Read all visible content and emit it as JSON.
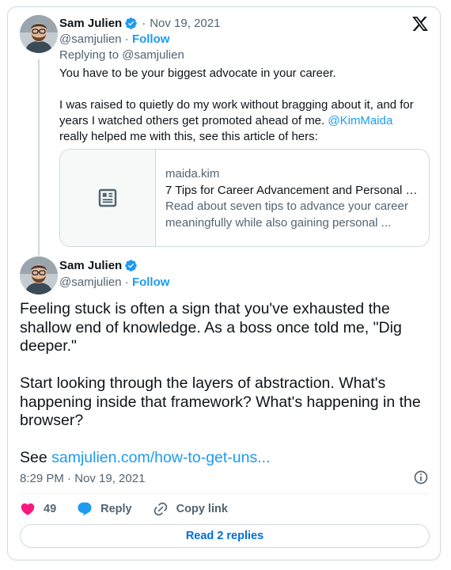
{
  "brand": {
    "logo_icon": "x-logo-icon",
    "verified_color": "#1d9bf0",
    "like_color": "#f91880"
  },
  "parent_tweet": {
    "author_name": "Sam Julien",
    "date": "Nov 19, 2021",
    "separator": "·",
    "handle": "@samjulien",
    "follow_label": "Follow",
    "replying_to": "Replying to @samjulien",
    "paragraph1": "You have to be your biggest advocate in your career.",
    "paragraph2_before": "I was raised to quietly do my work without bragging about it, and for years I watched others get promoted ahead of me. ",
    "paragraph2_mention": "@KimMaida",
    "paragraph2_after": " really helped me with this, see this article of hers:",
    "link_card": {
      "domain": "maida.kim",
      "title": "7 Tips for Career Advancement and Personal Fu...",
      "description": "Read about seven tips to advance your career meaningfully while also gaining personal ..."
    }
  },
  "main_tweet": {
    "author_name": "Sam Julien",
    "handle": "@samjulien",
    "separator": "·",
    "follow_label": "Follow",
    "paragraph1": "Feeling stuck is often a sign that you've exhausted the shallow end of knowledge. As a boss once told me, \"Dig deeper.\"",
    "paragraph2": "Start looking through the layers of abstraction. What's happening inside that framework? What's happening in the browser?",
    "paragraph3_prefix": "See ",
    "paragraph3_link": "samjulien.com/how-to-get-uns...",
    "timestamp": "8:29 PM · Nov 19, 2021"
  },
  "actions": {
    "like_count": "49",
    "reply_label": "Reply",
    "copy_label": "Copy link"
  },
  "read_replies_label": "Read 2 replies"
}
